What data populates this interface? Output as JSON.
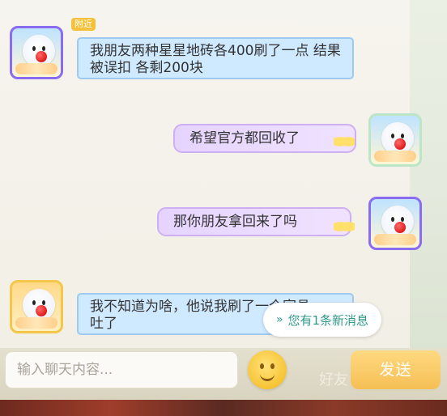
{
  "tag": "附近",
  "messages": [
    {
      "side": "left",
      "text": "我朋友两种星星地砖各400刷了一点 结果被误扣 各剩200块"
    },
    {
      "side": "right",
      "text": "希望官方都回收了"
    },
    {
      "side": "right",
      "text": "那你朋友拿回来了吗"
    },
    {
      "side": "left",
      "text": "我不知道为啥，他说我刷了一个家具。。。吐了"
    }
  ],
  "new_message_notice": "您有1条新消息",
  "new_message_chevron": "»",
  "input_placeholder": "输入聊天内容...",
  "send_label": "发送",
  "behind_text": "好友",
  "icons": {
    "emoji": "smile-emoji-icon",
    "chevron": "chevron-double-down-icon"
  },
  "colors": {
    "left_bubble": "#cfe9ff",
    "right_bubble": "#e6d4ff",
    "send": "#f5bf55",
    "notice_text": "#2f9a8b"
  }
}
